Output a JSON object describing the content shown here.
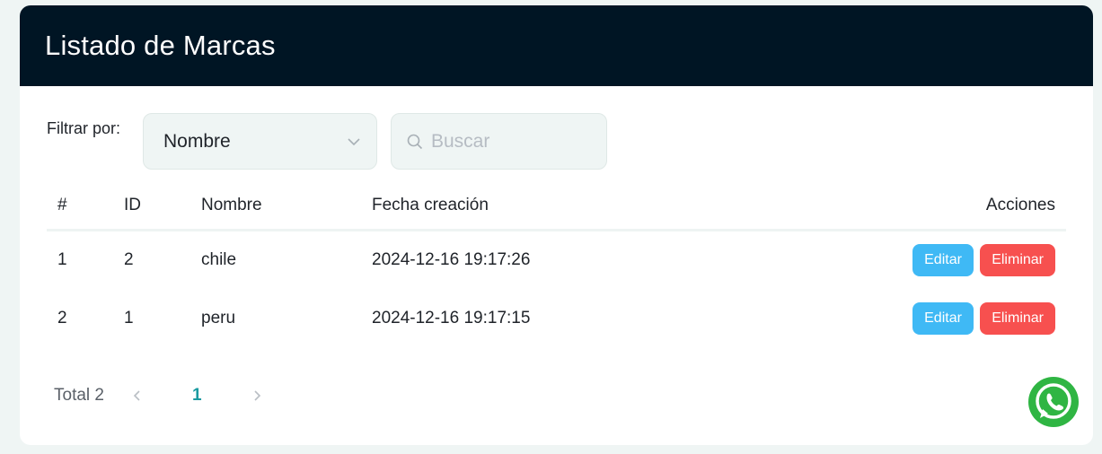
{
  "header": {
    "title": "Listado de Marcas"
  },
  "filter": {
    "label": "Filtrar por:",
    "selected": "Nombre",
    "search_placeholder": "Buscar"
  },
  "table": {
    "headers": [
      "#",
      "ID",
      "Nombre",
      "Fecha creación",
      "Acciones"
    ],
    "rows": [
      {
        "num": "1",
        "id": "2",
        "name": "chile",
        "date": "2024-12-16 19:17:26",
        "edit": "Editar",
        "delete": "Eliminar"
      },
      {
        "num": "2",
        "id": "1",
        "name": "peru",
        "date": "2024-12-16 19:17:15",
        "edit": "Editar",
        "delete": "Eliminar"
      }
    ]
  },
  "pagination": {
    "total": "Total 2",
    "current_page": "1"
  },
  "icons": {
    "select": "chevron-down-icon",
    "search": "search-icon",
    "prev": "chevron-left-icon",
    "next": "chevron-right-icon",
    "whatsapp": "whatsapp-icon"
  },
  "colors": {
    "header_bg": "#001524",
    "edit_button": "#3fb9f5",
    "delete_button": "#f7504f",
    "active_page": "#1a9aa0",
    "whatsapp": "#2fb543"
  }
}
